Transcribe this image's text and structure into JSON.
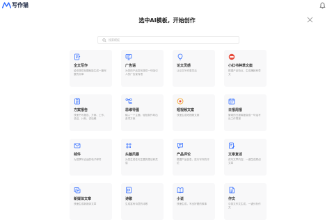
{
  "app": {
    "logo_text": "写作猫"
  },
  "dialog": {
    "title": "选中AI模板，开始创作"
  },
  "search": {
    "placeholder": "搜索模板"
  },
  "icons": {
    "header": [
      "logo-m-icon",
      "bell-icon",
      "close-icon",
      "search-icon"
    ]
  },
  "colors": {
    "accent": "#2f6bff",
    "red": "#e74c3c",
    "orange": "#f39c12",
    "card_bg": "#f8f8f9"
  },
  "templates": [
    {
      "title": "全文写作",
      "desc": "给你提供标题就能生成一篇完整的文章",
      "icon": "doc-icon"
    },
    {
      "title": "广告语",
      "desc": "为您的产品发布提供一句吸引人的广告宣传语",
      "icon": "monitor-icon"
    },
    {
      "title": "论文灵感",
      "desc": "让论文写作更灵活",
      "icon": "bulb-icon"
    },
    {
      "title": "小红书种草文案",
      "desc": "根据产品特点，生成爆款种草文",
      "icon": "red-badge-icon"
    },
    {
      "title": "方案报告",
      "desc": "快速书写报告、方案、工作、总结、计划、讲话稿",
      "icon": "report-icon"
    },
    {
      "title": "思维导图",
      "desc": "输入一个主题，轻松制作导出各项方案",
      "icon": "mindmap-icon"
    },
    {
      "title": "短视频文案",
      "desc": "快速生成短视频文案",
      "icon": "video-icon"
    },
    {
      "title": "日报周报",
      "desc": "繁琐的日报周报变成一句话写出工作周报",
      "icon": "calendar-icon"
    },
    {
      "title": "邮件",
      "desc": "为您撰写合适的电子邮件",
      "icon": "mail-icon"
    },
    {
      "title": "头脑风暴",
      "desc": "为您生成任何主题的想法和灵感",
      "icon": "storm-icon"
    },
    {
      "title": "产品评论",
      "desc": "根据产品信息，进行写作的评论",
      "icon": "comment-icon"
    },
    {
      "title": "文章复述",
      "desc": "改写文章内容，一键生成原创文章",
      "icon": "rewrite-icon"
    },
    {
      "title": "新媒体文章",
      "desc": "快速生成新媒体文章",
      "icon": "media-icon"
    },
    {
      "title": "诗歌",
      "desc": "生成富有诗意的诗歌",
      "icon": "poem-icon"
    },
    {
      "title": "小说",
      "desc": "快速生成，写出好看的故事",
      "icon": "novel-icon"
    },
    {
      "title": "作文",
      "desc": "中英文作文生成，一键分析作文",
      "icon": "essay-icon"
    }
  ]
}
